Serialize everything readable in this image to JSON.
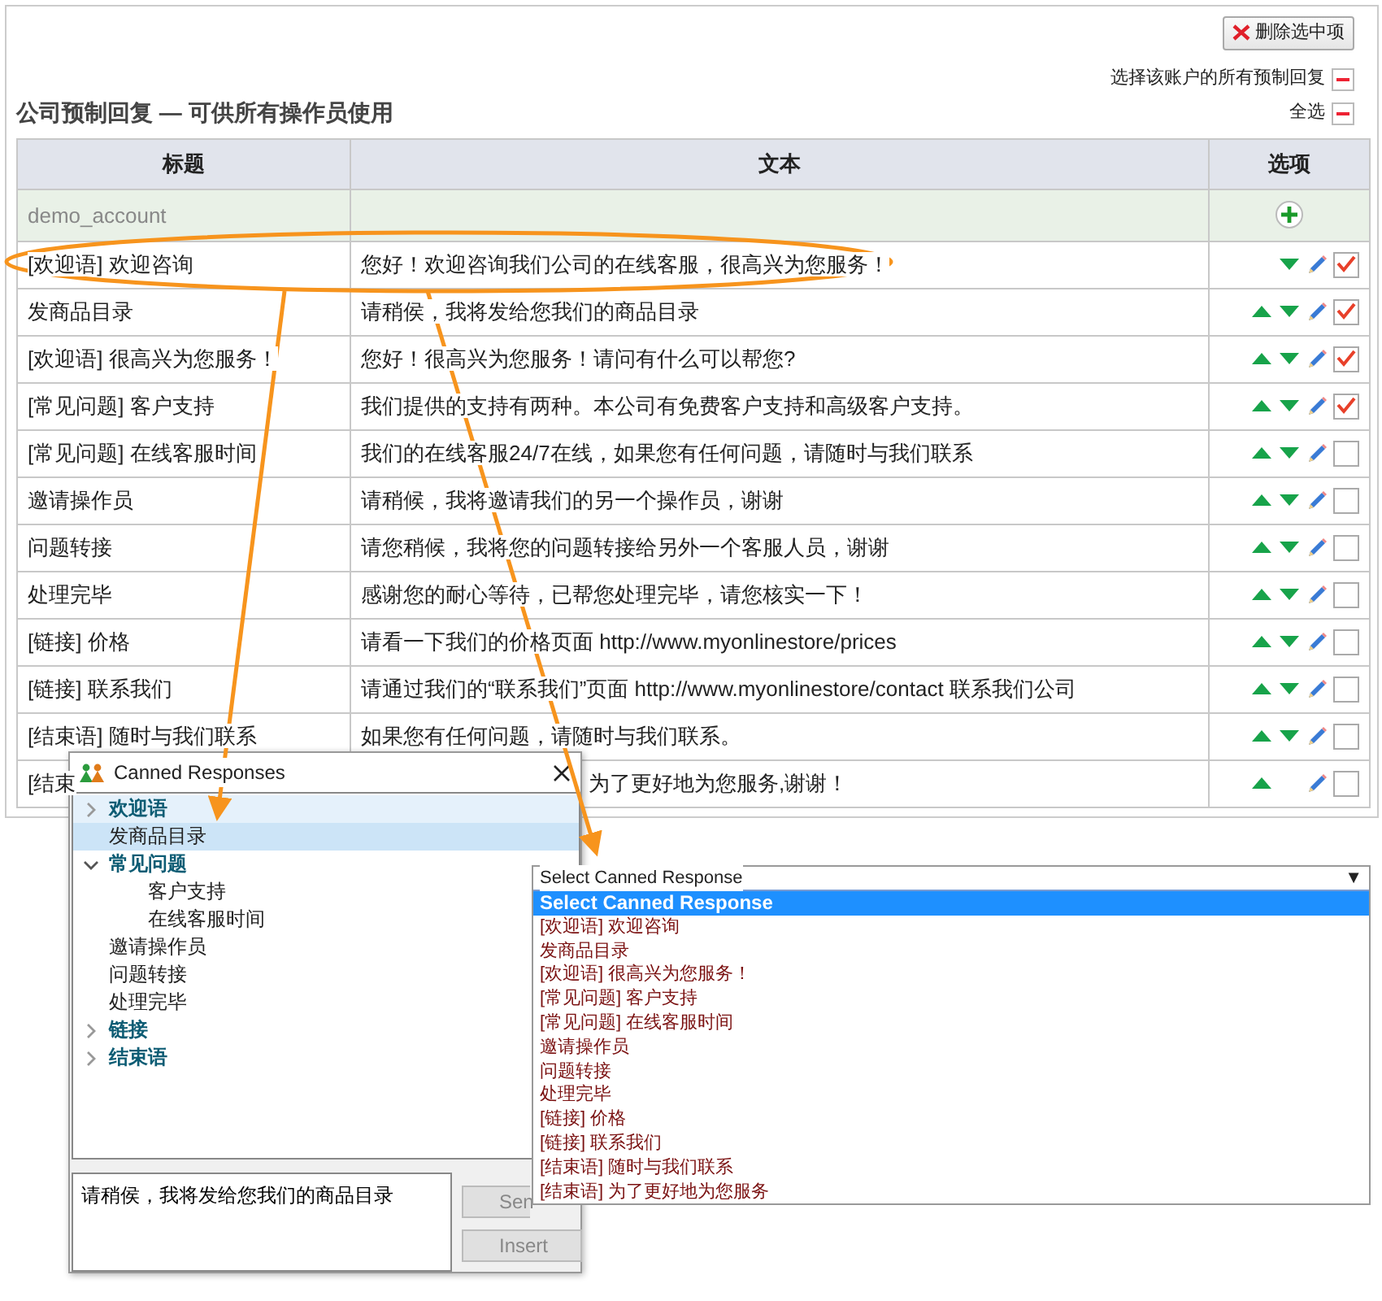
{
  "delete_button": "删除选中项",
  "select_options": [
    {
      "label": "选择该账户的所有预制回复",
      "on": false
    },
    {
      "label": "全选",
      "on": false
    }
  ],
  "heading": "公司预制回复 — 可供所有操作员使用",
  "table": {
    "columns": [
      "标题",
      "文本",
      "选项"
    ],
    "account": "demo_account",
    "rows": [
      {
        "title": "[欢迎语] 欢迎咨询",
        "text": "您好！欢迎咨询我们公司的在线客服，很高兴为您服务！",
        "can_up": false,
        "can_down": true,
        "checked": true
      },
      {
        "title": "发商品目录",
        "text": "请稍侯，我将发给您我们的商品目录",
        "can_up": true,
        "can_down": true,
        "checked": true
      },
      {
        "title": "[欢迎语] 很高兴为您服务！",
        "text": "您好！很高兴为您服务！请问有什么可以帮您?",
        "can_up": true,
        "can_down": true,
        "checked": true
      },
      {
        "title": "[常见问题] 客户支持",
        "text": "我们提供的支持有两种。本公司有免费客户支持和高级客户支持。",
        "can_up": true,
        "can_down": true,
        "checked": true
      },
      {
        "title": "[常见问题] 在线客服时间",
        "text": "我们的在线客服24/7在线，如果您有任何问题，请随时与我们联系",
        "can_up": true,
        "can_down": true,
        "checked": false
      },
      {
        "title": "邀请操作员",
        "text": "请稍候，我将邀请我们的另一个操作员，谢谢",
        "can_up": true,
        "can_down": true,
        "checked": false
      },
      {
        "title": "问题转接",
        "text": "请您稍候，我将您的问题转接给另外一个客服人员，谢谢",
        "can_up": true,
        "can_down": true,
        "checked": false
      },
      {
        "title": "处理完毕",
        "text": "感谢您的耐心等待，已帮您处理完毕，请您核实一下！",
        "can_up": true,
        "can_down": true,
        "checked": false
      },
      {
        "title": "[链接] 价格",
        "text": "请看一下我们的价格页面 http://www.myonlinestore/prices",
        "can_up": true,
        "can_down": true,
        "checked": false
      },
      {
        "title": "[链接] 联系我们",
        "text": "请通过我们的“联系我们”页面 http://www.myonlinestore/contact 联系我们公司",
        "can_up": true,
        "can_down": true,
        "checked": false
      },
      {
        "title": "[结束语] 随时与我们联系",
        "text": "如果您有任何问题，请随时与我们联系。",
        "can_up": true,
        "can_down": true,
        "checked": false
      },
      {
        "title": "[结束",
        "text": "为了更好地为您服务,谢谢！",
        "can_up": true,
        "can_down": false,
        "checked": false
      }
    ]
  },
  "popup": {
    "title": "Canned Responses",
    "tree": [
      {
        "label": "欢迎语",
        "kind": "group",
        "expanded": false,
        "selected": false,
        "hovered": true
      },
      {
        "label": "发商品目录",
        "kind": "item",
        "selected": true,
        "hovered": false
      },
      {
        "label": "常见问题",
        "kind": "group",
        "expanded": true,
        "selected": false,
        "hovered": false,
        "children": [
          {
            "label": "客户支持",
            "kind": "item",
            "selected": false,
            "hovered": false
          },
          {
            "label": "在线客服时间",
            "kind": "item",
            "selected": false,
            "hovered": false
          }
        ]
      },
      {
        "label": "邀请操作员",
        "kind": "item",
        "selected": false,
        "hovered": false
      },
      {
        "label": "问题转接",
        "kind": "item",
        "selected": false,
        "hovered": false
      },
      {
        "label": "处理完毕",
        "kind": "item",
        "selected": false,
        "hovered": false
      },
      {
        "label": "链接",
        "kind": "group",
        "expanded": false,
        "selected": false,
        "hovered": false
      },
      {
        "label": "结束语",
        "kind": "group",
        "expanded": false,
        "selected": false,
        "hovered": false
      }
    ],
    "message": "请稍侯，我将发给您我们的商品目录",
    "buttons": [
      {
        "label": "Sen",
        "disabled": true
      },
      {
        "label": "Insert",
        "disabled": true
      }
    ]
  },
  "dropdown": {
    "value": "Select Canned Response",
    "arrow": "▼",
    "options": [
      {
        "label": "Select Canned Response",
        "selected": true
      },
      {
        "label": "[欢迎语] 欢迎咨询",
        "selected": false
      },
      {
        "label": "发商品目录",
        "selected": false
      },
      {
        "label": "[欢迎语] 很高兴为您服务！",
        "selected": false
      },
      {
        "label": "[常见问题] 客户支持",
        "selected": false
      },
      {
        "label": "[常见问题] 在线客服时间",
        "selected": false
      },
      {
        "label": "邀请操作员",
        "selected": false
      },
      {
        "label": "问题转接",
        "selected": false
      },
      {
        "label": "处理完毕",
        "selected": false
      },
      {
        "label": "[链接] 价格",
        "selected": false
      },
      {
        "label": "[链接] 联系我们",
        "selected": false
      },
      {
        "label": "[结束语] 随时与我们联系",
        "selected": false
      },
      {
        "label": "[结束语] 为了更好地为您服务",
        "selected": false
      }
    ]
  }
}
